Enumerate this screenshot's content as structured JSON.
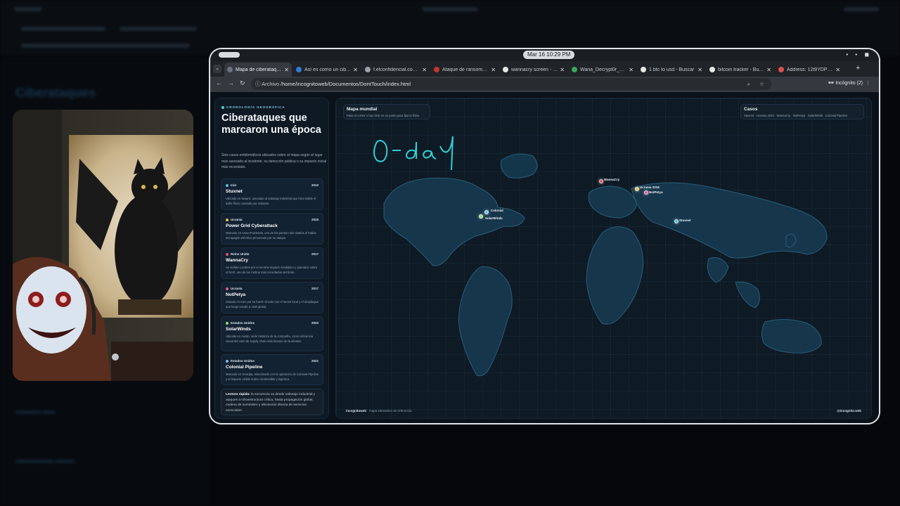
{
  "browser": {
    "clock": "Mar 16  10:29 PM",
    "tabs": [
      {
        "label": "Mapa de ciberataques",
        "fav": "#6b7480",
        "active": true
      },
      {
        "label": "Así es como un ciberataque",
        "fav": "#2f7bd6"
      },
      {
        "label": "f.elconfidencial.com/...",
        "fav": "#9aa1aa"
      },
      {
        "label": "Ataque de ransomware",
        "fav": "#c0392b"
      },
      {
        "label": "wannacry screen - Buscar",
        "fav": "#e6e6e6"
      },
      {
        "label": "Wana_Decrypt0r_screen",
        "fav": "#3ba55c"
      },
      {
        "label": "1 btc to usd - Buscar",
        "fav": "#e6e6e6"
      },
      {
        "label": "bitcoin tracker - Buscar",
        "fav": "#e6e6e6"
      },
      {
        "label": "Address: 12t9YDPgwue",
        "fav": "#d9534f"
      }
    ],
    "address_prefix": "Archivo",
    "url": "/home/incognitoweb/Documentos/DontTouch/index.html",
    "incognito_label": "Incógnito (2)"
  },
  "sidebar": {
    "eyebrow": "CRONOLOGÍA GEOGRÁFICA",
    "title": "Ciberataques que marcaron una época",
    "intro": "Seis casos emblemáticos ubicados sobre el mapa según el lugar más asociado al incidente, su detección pública o su impacto inicial más recordado.",
    "cases": [
      {
        "country": "Irán",
        "year": "2010",
        "name": "Stuxnet",
        "color": "#4fc3e0",
        "desc": "Ubicado en Natanz, asociado al sabotaje industrial que hizo visible el daño físico causado por malware."
      },
      {
        "country": "Ucrania",
        "year": "2015",
        "name": "Power Grid Cyberattack",
        "color": "#e8c34a",
        "desc": "Marcado en Ivano-Frankivsk, uno de los puntos más citados al hablar del apagón eléctrico provocado por un ataque."
      },
      {
        "country": "Reino Unido",
        "year": "2017",
        "name": "WannaCry",
        "color": "#e0566b",
        "desc": "Se señala Londres por el enorme impacto mediático y operativo sobre el NHS, uno de los rostros más recordados del brote."
      },
      {
        "country": "Ucrania",
        "year": "2017",
        "name": "NotPetya",
        "color": "#e05a9a",
        "desc": "Situado en Kiev por su fuerte vínculo con el sector local y el despliegue que luego escaló a nivel global."
      },
      {
        "country": "Estados Unidos",
        "year": "2020",
        "name": "SolarWinds",
        "color": "#8fe07a",
        "desc": "Ubicado en Austin, sede histórica de la compañía, como referencia visual del caso de supply chain más famoso de la década."
      },
      {
        "country": "Estados Unidos",
        "year": "2021",
        "name": "Colonial Pipeline",
        "color": "#7ab8f0",
        "desc": "Marcado en Georgia, relacionado con la operación de Colonial Pipeline y el impacto visible sobre combustible y logística."
      }
    ],
    "note_bold": "Lectura rápida:",
    "note_text": " la secuencia va desde sabotaje industrial y ataques a infraestructura crítica, hasta propagación global, cadena de suministro y afectación directa de servicios esenciales."
  },
  "map": {
    "title": "Mapa mundial",
    "subtitle": "Pasa el cursor o haz click en un punto para fijar la ficha.",
    "cases_title": "Casos",
    "cases_list": "Stuxnet · Ucrania 2015 · WannaCry · NotPetya · SolarWinds · Colonial Pipeline",
    "footer_brand": "incognitoweb",
    "footer_desc": " · mapa interactivo de referencia",
    "footer_right": "@incognito.web",
    "annotation": "0-day",
    "markers": [
      {
        "label": "WannaCry",
        "color": "#e0566b"
      },
      {
        "label": "Ucrania 2015",
        "color": "#e8c34a"
      },
      {
        "label": "NotPetya",
        "color": "#e05a9a"
      },
      {
        "label": "Stuxnet",
        "color": "#4fc3e0"
      },
      {
        "label": "Colonial",
        "color": "#7ab8f0"
      },
      {
        "label": "SolarWinds",
        "color": "#8fe07a"
      }
    ]
  }
}
